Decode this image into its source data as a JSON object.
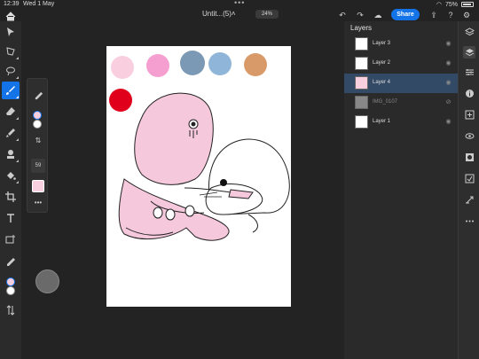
{
  "status": {
    "time": "12:39",
    "date": "Wed 1 May",
    "battery": "75%"
  },
  "topbar": {
    "doc_title": "Untit...(5)˄",
    "zoom": "24%",
    "share_label": "Share"
  },
  "left_tools": [
    {
      "name": "select-tool-icon"
    },
    {
      "name": "transform-tool-icon"
    },
    {
      "name": "lasso-tool-icon"
    },
    {
      "name": "brush-tool-icon",
      "active": true
    },
    {
      "name": "eraser-tool-icon"
    },
    {
      "name": "smudge-tool-icon"
    },
    {
      "name": "clone-stamp-tool-icon"
    },
    {
      "name": "fill-tool-icon"
    },
    {
      "name": "crop-tool-icon"
    },
    {
      "name": "type-tool-icon"
    },
    {
      "name": "place-image-icon"
    },
    {
      "name": "eyedropper-tool-icon"
    }
  ],
  "colors": {
    "primary": "#f7cfdf",
    "secondary": "#ffffff",
    "accent": "#1473e6"
  },
  "brush_flyout": {
    "value": "59"
  },
  "canvas_palette": [
    "#f9cfe0",
    "#f59fd0",
    "#7b98b4",
    "#8fb5d8",
    "#d99a6a",
    "#e0001b"
  ],
  "layers_panel": {
    "title": "Layers",
    "layers": [
      {
        "name": "Layer 3",
        "selected": false,
        "hidden": false
      },
      {
        "name": "Layer 2",
        "selected": false,
        "hidden": false
      },
      {
        "name": "Layer 4",
        "selected": true,
        "hidden": false
      },
      {
        "name": "IMG_0107",
        "selected": false,
        "hidden": true
      },
      {
        "name": "Layer 1",
        "selected": false,
        "hidden": false
      }
    ]
  },
  "right_rail": [
    {
      "name": "layers-icon"
    },
    {
      "name": "layer-properties-icon",
      "active": true
    },
    {
      "name": "adjustments-icon"
    },
    {
      "name": "layer-info-icon"
    },
    {
      "name": "add-layer-icon"
    },
    {
      "name": "visibility-icon"
    },
    {
      "name": "mask-icon"
    },
    {
      "name": "clip-icon"
    },
    {
      "name": "fx-icon"
    },
    {
      "name": "more-icon"
    }
  ]
}
